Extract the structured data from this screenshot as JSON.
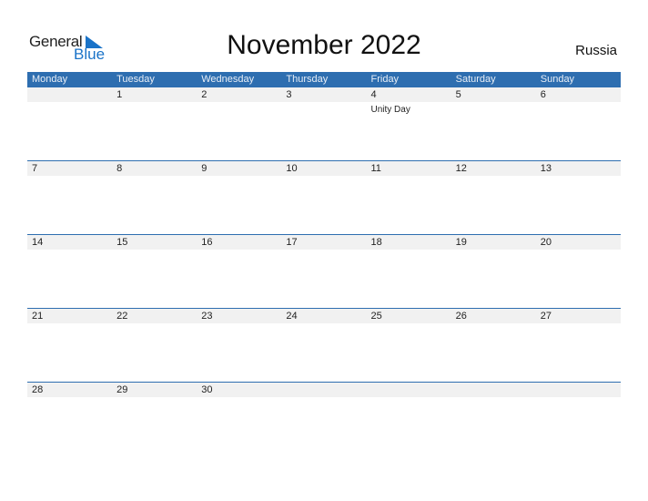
{
  "logo": {
    "general": "General",
    "blue": "Blue"
  },
  "title": "November 2022",
  "country": "Russia",
  "weekdays": [
    "Monday",
    "Tuesday",
    "Wednesday",
    "Thursday",
    "Friday",
    "Saturday",
    "Sunday"
  ],
  "weeks": [
    {
      "days": [
        "",
        "1",
        "2",
        "3",
        "4",
        "5",
        "6"
      ],
      "events": [
        "",
        "",
        "",
        "",
        "Unity Day",
        "",
        ""
      ]
    },
    {
      "days": [
        "7",
        "8",
        "9",
        "10",
        "11",
        "12",
        "13"
      ],
      "events": [
        "",
        "",
        "",
        "",
        "",
        "",
        ""
      ]
    },
    {
      "days": [
        "14",
        "15",
        "16",
        "17",
        "18",
        "19",
        "20"
      ],
      "events": [
        "",
        "",
        "",
        "",
        "",
        "",
        ""
      ]
    },
    {
      "days": [
        "21",
        "22",
        "23",
        "24",
        "25",
        "26",
        "27"
      ],
      "events": [
        "",
        "",
        "",
        "",
        "",
        "",
        ""
      ]
    },
    {
      "days": [
        "28",
        "29",
        "30",
        "",
        "",
        "",
        ""
      ],
      "events": [
        "",
        "",
        "",
        "",
        "",
        "",
        ""
      ]
    }
  ],
  "colors": {
    "header": "#2e6eb0",
    "brand_blue": "#1a73c8",
    "row_bg": "#f1f1f1"
  }
}
